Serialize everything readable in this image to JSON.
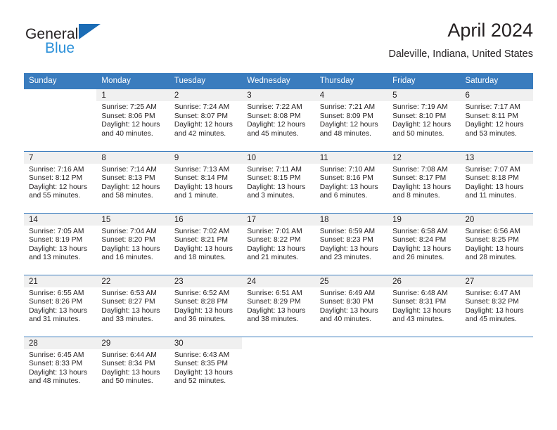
{
  "brand": {
    "name_top": "General",
    "name_bottom": "Blue",
    "triangle_icon": "blue-triangle-icon",
    "accent_color": "#1b6cb5",
    "accent_color_light": "#2b90d9"
  },
  "header": {
    "title": "April 2024",
    "subtitle": "Daleville, Indiana, United States"
  },
  "calendar": {
    "header_bg": "#3a7cbe",
    "daynum_bg": "#f0f0f0",
    "weekday_headers": [
      "Sunday",
      "Monday",
      "Tuesday",
      "Wednesday",
      "Thursday",
      "Friday",
      "Saturday"
    ],
    "weeks": [
      [
        {
          "day": "",
          "sunrise": "",
          "sunset": "",
          "daylight_line1": "",
          "daylight_line2": ""
        },
        {
          "day": "1",
          "sunrise": "Sunrise: 7:25 AM",
          "sunset": "Sunset: 8:06 PM",
          "daylight_line1": "Daylight: 12 hours",
          "daylight_line2": "and 40 minutes."
        },
        {
          "day": "2",
          "sunrise": "Sunrise: 7:24 AM",
          "sunset": "Sunset: 8:07 PM",
          "daylight_line1": "Daylight: 12 hours",
          "daylight_line2": "and 42 minutes."
        },
        {
          "day": "3",
          "sunrise": "Sunrise: 7:22 AM",
          "sunset": "Sunset: 8:08 PM",
          "daylight_line1": "Daylight: 12 hours",
          "daylight_line2": "and 45 minutes."
        },
        {
          "day": "4",
          "sunrise": "Sunrise: 7:21 AM",
          "sunset": "Sunset: 8:09 PM",
          "daylight_line1": "Daylight: 12 hours",
          "daylight_line2": "and 48 minutes."
        },
        {
          "day": "5",
          "sunrise": "Sunrise: 7:19 AM",
          "sunset": "Sunset: 8:10 PM",
          "daylight_line1": "Daylight: 12 hours",
          "daylight_line2": "and 50 minutes."
        },
        {
          "day": "6",
          "sunrise": "Sunrise: 7:17 AM",
          "sunset": "Sunset: 8:11 PM",
          "daylight_line1": "Daylight: 12 hours",
          "daylight_line2": "and 53 minutes."
        }
      ],
      [
        {
          "day": "7",
          "sunrise": "Sunrise: 7:16 AM",
          "sunset": "Sunset: 8:12 PM",
          "daylight_line1": "Daylight: 12 hours",
          "daylight_line2": "and 55 minutes."
        },
        {
          "day": "8",
          "sunrise": "Sunrise: 7:14 AM",
          "sunset": "Sunset: 8:13 PM",
          "daylight_line1": "Daylight: 12 hours",
          "daylight_line2": "and 58 minutes."
        },
        {
          "day": "9",
          "sunrise": "Sunrise: 7:13 AM",
          "sunset": "Sunset: 8:14 PM",
          "daylight_line1": "Daylight: 13 hours",
          "daylight_line2": "and 1 minute."
        },
        {
          "day": "10",
          "sunrise": "Sunrise: 7:11 AM",
          "sunset": "Sunset: 8:15 PM",
          "daylight_line1": "Daylight: 13 hours",
          "daylight_line2": "and 3 minutes."
        },
        {
          "day": "11",
          "sunrise": "Sunrise: 7:10 AM",
          "sunset": "Sunset: 8:16 PM",
          "daylight_line1": "Daylight: 13 hours",
          "daylight_line2": "and 6 minutes."
        },
        {
          "day": "12",
          "sunrise": "Sunrise: 7:08 AM",
          "sunset": "Sunset: 8:17 PM",
          "daylight_line1": "Daylight: 13 hours",
          "daylight_line2": "and 8 minutes."
        },
        {
          "day": "13",
          "sunrise": "Sunrise: 7:07 AM",
          "sunset": "Sunset: 8:18 PM",
          "daylight_line1": "Daylight: 13 hours",
          "daylight_line2": "and 11 minutes."
        }
      ],
      [
        {
          "day": "14",
          "sunrise": "Sunrise: 7:05 AM",
          "sunset": "Sunset: 8:19 PM",
          "daylight_line1": "Daylight: 13 hours",
          "daylight_line2": "and 13 minutes."
        },
        {
          "day": "15",
          "sunrise": "Sunrise: 7:04 AM",
          "sunset": "Sunset: 8:20 PM",
          "daylight_line1": "Daylight: 13 hours",
          "daylight_line2": "and 16 minutes."
        },
        {
          "day": "16",
          "sunrise": "Sunrise: 7:02 AM",
          "sunset": "Sunset: 8:21 PM",
          "daylight_line1": "Daylight: 13 hours",
          "daylight_line2": "and 18 minutes."
        },
        {
          "day": "17",
          "sunrise": "Sunrise: 7:01 AM",
          "sunset": "Sunset: 8:22 PM",
          "daylight_line1": "Daylight: 13 hours",
          "daylight_line2": "and 21 minutes."
        },
        {
          "day": "18",
          "sunrise": "Sunrise: 6:59 AM",
          "sunset": "Sunset: 8:23 PM",
          "daylight_line1": "Daylight: 13 hours",
          "daylight_line2": "and 23 minutes."
        },
        {
          "day": "19",
          "sunrise": "Sunrise: 6:58 AM",
          "sunset": "Sunset: 8:24 PM",
          "daylight_line1": "Daylight: 13 hours",
          "daylight_line2": "and 26 minutes."
        },
        {
          "day": "20",
          "sunrise": "Sunrise: 6:56 AM",
          "sunset": "Sunset: 8:25 PM",
          "daylight_line1": "Daylight: 13 hours",
          "daylight_line2": "and 28 minutes."
        }
      ],
      [
        {
          "day": "21",
          "sunrise": "Sunrise: 6:55 AM",
          "sunset": "Sunset: 8:26 PM",
          "daylight_line1": "Daylight: 13 hours",
          "daylight_line2": "and 31 minutes."
        },
        {
          "day": "22",
          "sunrise": "Sunrise: 6:53 AM",
          "sunset": "Sunset: 8:27 PM",
          "daylight_line1": "Daylight: 13 hours",
          "daylight_line2": "and 33 minutes."
        },
        {
          "day": "23",
          "sunrise": "Sunrise: 6:52 AM",
          "sunset": "Sunset: 8:28 PM",
          "daylight_line1": "Daylight: 13 hours",
          "daylight_line2": "and 36 minutes."
        },
        {
          "day": "24",
          "sunrise": "Sunrise: 6:51 AM",
          "sunset": "Sunset: 8:29 PM",
          "daylight_line1": "Daylight: 13 hours",
          "daylight_line2": "and 38 minutes."
        },
        {
          "day": "25",
          "sunrise": "Sunrise: 6:49 AM",
          "sunset": "Sunset: 8:30 PM",
          "daylight_line1": "Daylight: 13 hours",
          "daylight_line2": "and 40 minutes."
        },
        {
          "day": "26",
          "sunrise": "Sunrise: 6:48 AM",
          "sunset": "Sunset: 8:31 PM",
          "daylight_line1": "Daylight: 13 hours",
          "daylight_line2": "and 43 minutes."
        },
        {
          "day": "27",
          "sunrise": "Sunrise: 6:47 AM",
          "sunset": "Sunset: 8:32 PM",
          "daylight_line1": "Daylight: 13 hours",
          "daylight_line2": "and 45 minutes."
        }
      ],
      [
        {
          "day": "28",
          "sunrise": "Sunrise: 6:45 AM",
          "sunset": "Sunset: 8:33 PM",
          "daylight_line1": "Daylight: 13 hours",
          "daylight_line2": "and 48 minutes."
        },
        {
          "day": "29",
          "sunrise": "Sunrise: 6:44 AM",
          "sunset": "Sunset: 8:34 PM",
          "daylight_line1": "Daylight: 13 hours",
          "daylight_line2": "and 50 minutes."
        },
        {
          "day": "30",
          "sunrise": "Sunrise: 6:43 AM",
          "sunset": "Sunset: 8:35 PM",
          "daylight_line1": "Daylight: 13 hours",
          "daylight_line2": "and 52 minutes."
        },
        {
          "day": "",
          "sunrise": "",
          "sunset": "",
          "daylight_line1": "",
          "daylight_line2": ""
        },
        {
          "day": "",
          "sunrise": "",
          "sunset": "",
          "daylight_line1": "",
          "daylight_line2": ""
        },
        {
          "day": "",
          "sunrise": "",
          "sunset": "",
          "daylight_line1": "",
          "daylight_line2": ""
        },
        {
          "day": "",
          "sunrise": "",
          "sunset": "",
          "daylight_line1": "",
          "daylight_line2": ""
        }
      ]
    ]
  }
}
